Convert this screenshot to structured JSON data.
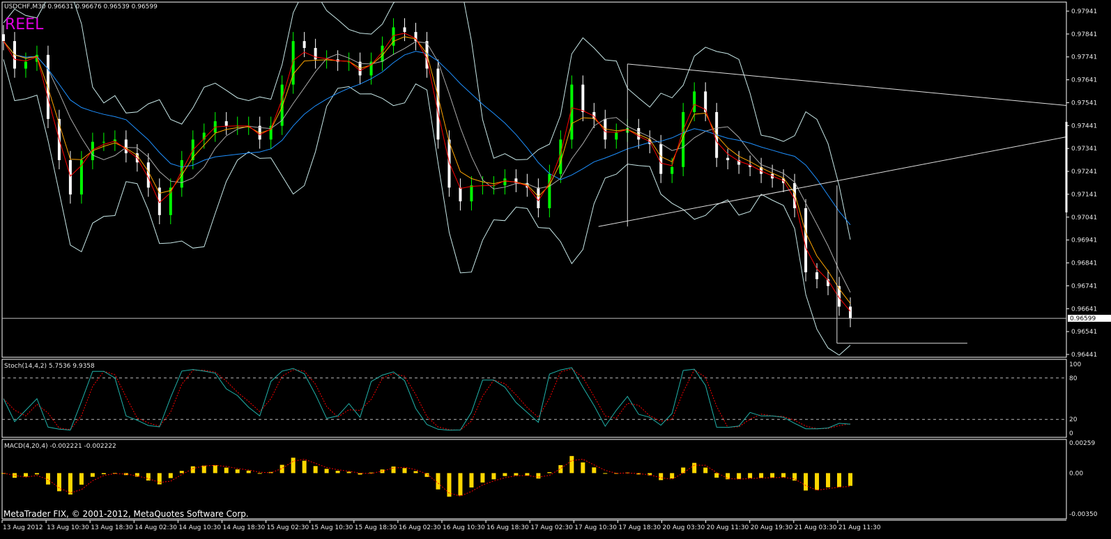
{
  "header": {
    "symbol_info": "USDCHF,M30  0.96631 0.96676 0.96539 0.96599",
    "overlay_label": "REEL"
  },
  "footer": {
    "copyright": "MetaTrader FIX, © 2001-2012, MetaQuotes Software Corp."
  },
  "colors": {
    "bull": "#00ff00",
    "bear": "#ffffff",
    "ma_fast": "#ff0000",
    "ma_mid": "#ffa500",
    "ma_slow": "#1e90ff",
    "bands": "#c8e8e8",
    "stoch_main": "#20b2aa",
    "stoch_signal": "#ff0000",
    "macd_hist": "#ffd700",
    "macd_signal": "#ff0000"
  },
  "chart_data": [
    {
      "type": "candlestick",
      "title": "USDCHF,M30",
      "ohlc_last": {
        "open": 0.96631,
        "high": 0.96676,
        "low": 0.96539,
        "close": 0.96599
      },
      "current_price_label": "0.96599",
      "ylim": [
        0.96441,
        0.97941
      ],
      "yticks": [
        "0.97941",
        "0.97841",
        "0.97741",
        "0.97641",
        "0.97541",
        "0.97441",
        "0.97341",
        "0.97241",
        "0.97141",
        "0.97041",
        "0.96941",
        "0.96841",
        "0.96741",
        "0.96641",
        "0.96541",
        "0.96441"
      ],
      "xticks": [
        "13 Aug 2012",
        "13 Aug 10:30",
        "13 Aug 18:30",
        "14 Aug 02:30",
        "14 Aug 10:30",
        "14 Aug 18:30",
        "15 Aug 02:30",
        "15 Aug 10:30",
        "15 Aug 18:30",
        "16 Aug 02:30",
        "16 Aug 10:30",
        "16 Aug 18:30",
        "17 Aug 02:30",
        "17 Aug 10:30",
        "17 Aug 18:30",
        "20 Aug 03:30",
        "20 Aug 11:30",
        "20 Aug 19:30",
        "21 Aug 03:30",
        "21 Aug 11:30"
      ],
      "closes_sampled": [
        0.9781,
        0.9769,
        0.9772,
        0.9775,
        0.9747,
        0.9729,
        0.9714,
        0.9729,
        0.9737,
        0.9737,
        0.9738,
        0.9732,
        0.9728,
        0.9717,
        0.9705,
        0.9717,
        0.9729,
        0.9738,
        0.9741,
        0.9746,
        0.9744,
        0.9744,
        0.9744,
        0.9738,
        0.9744,
        0.9762,
        0.9781,
        0.9778,
        0.9773,
        0.9773,
        0.9772,
        0.9772,
        0.9766,
        0.9772,
        0.9779,
        0.9787,
        0.9785,
        0.9781,
        0.9769,
        0.9738,
        0.9717,
        0.9711,
        0.9718,
        0.9718,
        0.9718,
        0.9721,
        0.9719,
        0.9717,
        0.9708,
        0.9723,
        0.9738,
        0.9762,
        0.975,
        0.9747,
        0.9738,
        0.9741,
        0.9743,
        0.9738,
        0.9736,
        0.9723,
        0.9726,
        0.975,
        0.9759,
        0.975,
        0.973,
        0.9729,
        0.9727,
        0.9726,
        0.9723,
        0.9721,
        0.9719,
        0.9708,
        0.968,
        0.9677,
        0.9674,
        0.9665,
        0.966
      ],
      "trendlines": [
        {
          "from": [
            56,
            0.9771
          ],
          "to": [
            99.5,
            0.9751
          ]
        },
        {
          "from": [
            53.4,
            0.97
          ],
          "to": [
            99.5,
            0.9743
          ]
        },
        {
          "from": [
            56,
            0.9771
          ],
          "to": [
            56,
            0.97
          ]
        },
        {
          "from": [
            74.8,
            0.9718
          ],
          "to": [
            74.8,
            0.9649
          ]
        },
        {
          "from": [
            74.8,
            0.9649
          ],
          "to": [
            86.5,
            0.9649
          ]
        }
      ]
    },
    {
      "type": "line",
      "title": "Stoch(14,4,2) 5.7536 9.9358",
      "ylim": [
        0,
        100
      ],
      "levels": [
        80,
        20
      ],
      "yticks": [
        "100",
        "80",
        "20",
        "0"
      ],
      "last": {
        "main": 5.7536,
        "signal": 9.9358
      }
    },
    {
      "type": "bar",
      "title": "MACD(4,20,4) -0.002221 -0.002222",
      "ylim": [
        -0.0035,
        0.00259
      ],
      "yticks": [
        "0.00259",
        "0.00",
        "-0.00350"
      ],
      "last": {
        "macd": -0.002221,
        "signal": -0.002222
      }
    }
  ]
}
